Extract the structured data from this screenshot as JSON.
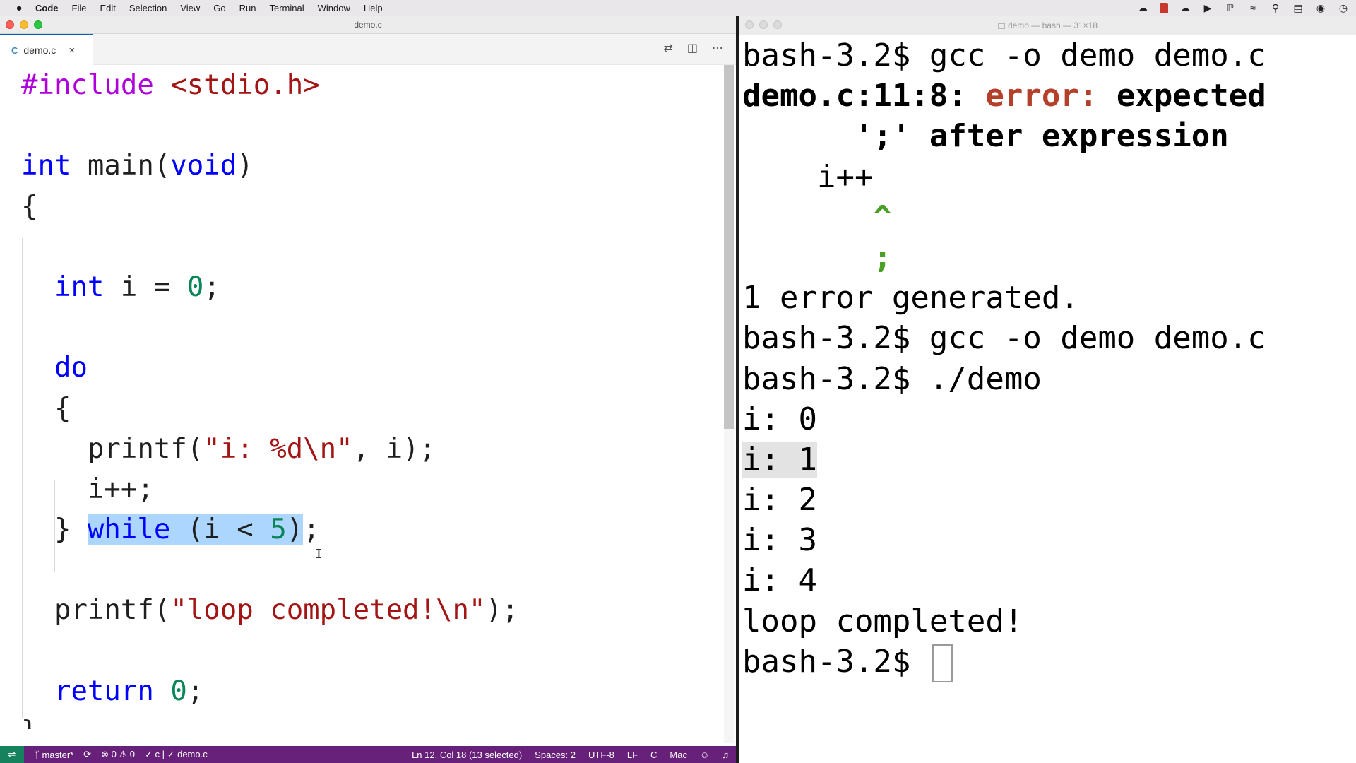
{
  "menubar": {
    "items": [
      "Code",
      "File",
      "Edit",
      "Selection",
      "View",
      "Go",
      "Run",
      "Terminal",
      "Window",
      "Help"
    ]
  },
  "vscode": {
    "window_title": "demo.c",
    "tab": {
      "icon": "C",
      "label": "demo.c"
    },
    "code_lines": [
      "#include <stdio.h>",
      "",
      "int main(void)",
      "{",
      "",
      "  int i = 0;",
      "",
      "  do",
      "  {",
      "    printf(\"i: %d\\n\", i);",
      "    i++;",
      "  } while (i < 5);",
      "",
      "  printf(\"loop completed!\\n\");",
      "",
      "  return 0;",
      "}"
    ],
    "selection": "while (i < 5)",
    "status": {
      "branch": "master*",
      "problems": "⊗ 0 ⚠ 0",
      "lint": "✓ c | ✓ demo.c",
      "position": "Ln 12, Col 18 (13 selected)",
      "spaces": "Spaces: 2",
      "encoding": "UTF-8",
      "eol": "LF",
      "language": "C",
      "platform": "Mac"
    }
  },
  "terminal": {
    "window_title": "demo — bash — 31×18",
    "lines": [
      "bash-3.2$ gcc -o demo demo.c",
      "demo.c:11:8: error: expected",
      "      ';' after expression",
      "    i++",
      "       ^",
      "       ;",
      "1 error generated.",
      "bash-3.2$ gcc -o demo demo.c",
      "bash-3.2$ ./demo",
      "i: 0",
      "i: 1",
      "i: 2",
      "i: 3",
      "i: 4",
      "loop completed!",
      "bash-3.2$ "
    ]
  },
  "colors": {
    "keyword": "#0000ff",
    "string": "#a31515",
    "number": "#098658",
    "selection": "#add6ff",
    "statusbar": "#68217a",
    "error": "#b5402a",
    "caret_hint": "#4a9f27"
  },
  "icons": [
    "apple-icon",
    "c-file-icon",
    "close-icon",
    "compare-changes-icon",
    "split-editor-icon",
    "more-actions-icon",
    "source-control-branch-icon",
    "sync-icon",
    "remote-icon",
    "feedback-icon",
    "bell-icon",
    "wifi-icon",
    "bluetooth-icon",
    "search-icon",
    "control-center-icon"
  ]
}
